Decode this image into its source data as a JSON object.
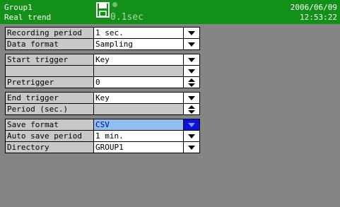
{
  "header": {
    "group": "Group1",
    "mode": "Real trend",
    "date": "2006/06/09",
    "time": "12:53:22",
    "rate": "0.1sec"
  },
  "colors": {
    "header_bg": "#129018",
    "selected_value_bg": "#8fc0f0",
    "selected_button_bg": "#0a14d8",
    "label_bg": "#c8c8c8",
    "screen_bg": "#858585"
  },
  "settings": {
    "recording_period": {
      "label": "Recording period",
      "value": " 1 sec."
    },
    "data_format": {
      "label": "Data format",
      "value": "Sampling"
    },
    "start_trigger": {
      "label": "Start trigger",
      "value": "Key"
    },
    "start_trigger_sub": {
      "label": "",
      "value": ""
    },
    "pretrigger": {
      "label": "Pretrigger",
      "value": "0"
    },
    "end_trigger": {
      "label": "End trigger",
      "value": "Key"
    },
    "period_sec": {
      "label": "Period (sec.)",
      "value": ""
    },
    "save_format": {
      "label": "Save format",
      "value": "CSV"
    },
    "auto_save_period": {
      "label": "Auto save period",
      "value": " 1 min."
    },
    "directory": {
      "label": "Directory",
      "value": "GROUP1"
    }
  }
}
